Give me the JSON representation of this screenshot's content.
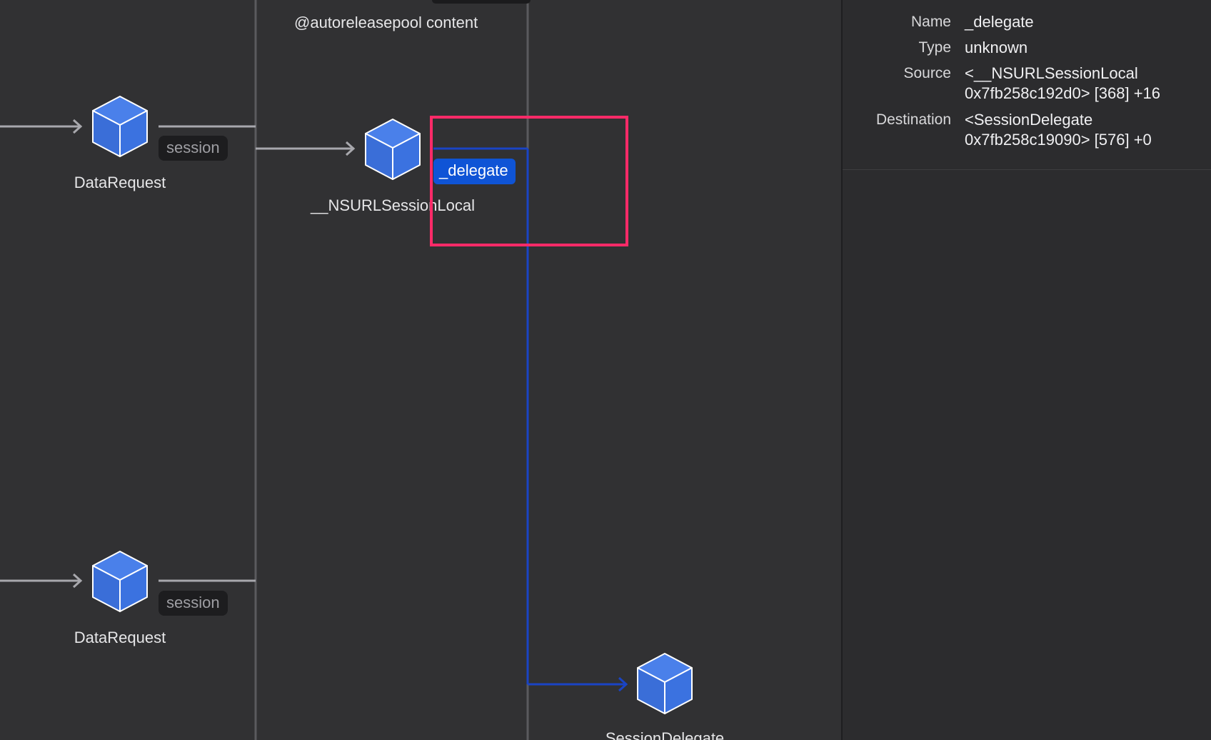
{
  "graph": {
    "section_title": "@autoreleasepool content",
    "nodes": {
      "data_request_top": {
        "label": "DataRequest",
        "edge_label": "session"
      },
      "nsurl_session_local": {
        "label": "__NSURLSessionLocal",
        "edge_label": "_delegate"
      },
      "data_request_bottom": {
        "label": "DataRequest",
        "edge_label": "session"
      },
      "session_delegate": {
        "label": "SessionDelegate"
      }
    },
    "icon": "cube-icon"
  },
  "inspector": {
    "name_label": "Name",
    "name_value": "_delegate",
    "type_label": "Type",
    "type_value": "unknown",
    "source_label": "Source",
    "source_line1": "<__NSURLSessionLocal",
    "source_line2": "0x7fb258c192d0> [368] +16",
    "destination_label": "Destination",
    "destination_line1": "<SessionDelegate",
    "destination_line2": "0x7fb258c19090> [576] +0"
  },
  "colors": {
    "background": "#313133",
    "node_blue": "#3b72e0",
    "selected_edge": "#1a44c4",
    "selected_pill": "#0f54d6",
    "highlight": "#ff2a68",
    "edge_gray": "#a8a8ad"
  }
}
